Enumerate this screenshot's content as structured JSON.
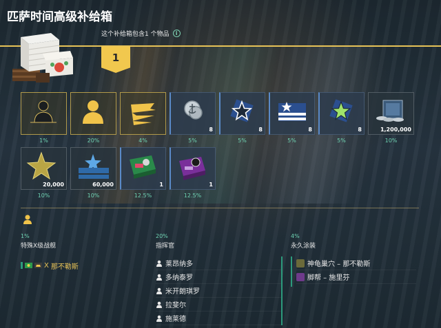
{
  "header": {
    "title": "匹萨时间高级补给箱",
    "info_text": "这个补给箱包含1 个物品",
    "count": "1"
  },
  "items": [
    {
      "name": "ship-item",
      "qty": "",
      "pct": "1%",
      "style": "gold",
      "icon": "silhouette-ship-icon"
    },
    {
      "name": "commander-item",
      "qty": "",
      "pct": "20%",
      "style": "gold",
      "icon": "commander-icon"
    },
    {
      "name": "camouflage-item",
      "qty": "",
      "pct": "4%",
      "style": "gold",
      "icon": "camouflage-icon"
    },
    {
      "name": "signal-anchor-item",
      "qty": "8",
      "pct": "5%",
      "style": "blue",
      "icon": "anchor-coin-icon"
    },
    {
      "name": "star-item-1",
      "qty": "8",
      "pct": "5%",
      "style": "blue",
      "icon": "star-icon"
    },
    {
      "name": "star-stripes-item",
      "qty": "8",
      "pct": "5%",
      "style": "blue",
      "icon": "star-stripes-icon"
    },
    {
      "name": "green-star-item",
      "qty": "8",
      "pct": "5%",
      "style": "blue",
      "icon": "green-star-icon"
    },
    {
      "name": "credits-item",
      "qty": "1,200,000",
      "pct": "10%",
      "style": "plain",
      "icon": "credits-icon"
    },
    {
      "name": "elite-xp-item",
      "qty": "20,000",
      "pct": "10%",
      "style": "plain",
      "icon": "gold-star-icon"
    },
    {
      "name": "free-xp-item",
      "qty": "60,000",
      "pct": "10%",
      "style": "plain",
      "icon": "blue-star-icon"
    },
    {
      "name": "economic-bonus-green-item",
      "qty": "1",
      "pct": "12.5%",
      "style": "blue",
      "icon": "green-bonus-icon"
    },
    {
      "name": "economic-bonus-purple-item",
      "qty": "1",
      "pct": "12.5%",
      "style": "blue",
      "icon": "purple-bonus-icon"
    }
  ],
  "details": {
    "ships": {
      "pct": "1%",
      "title": "特殊X级战舰",
      "entries": [
        {
          "tier": "X",
          "name": "那不勒斯"
        }
      ]
    },
    "commanders": {
      "pct": "20%",
      "title": "指挥官",
      "entries": [
        "莱昂纳多",
        "多纳泰罗",
        "米开朗琪罗",
        "拉斐尔",
        "施莱德"
      ]
    },
    "camouflage": {
      "pct": "4%",
      "title": "永久涂装",
      "entries": [
        "神龟巢穴 – 那不勒斯",
        "脚帮 – 施里芬"
      ]
    }
  },
  "colors": {
    "accent_gold": "#e8c357",
    "percent_green": "#6fd3b3",
    "badge_yellow": "#f1c84e"
  }
}
